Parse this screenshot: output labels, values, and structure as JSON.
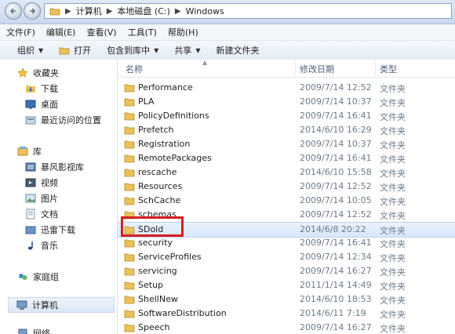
{
  "breadcrumb": [
    "计算机",
    "本地磁盘 (C:)",
    "Windows"
  ],
  "menu": [
    "文件(F)",
    "编辑(E)",
    "查看(V)",
    "工具(T)",
    "帮助(H)"
  ],
  "toolbar": {
    "organize": "组织",
    "open": "打开",
    "include": "包含到库中",
    "share": "共享",
    "new_folder": "新建文件夹"
  },
  "nav": {
    "favorites": "收藏夹",
    "downloads": "下载",
    "desktop": "桌面",
    "recent": "最近访问的位置",
    "libraries": "库",
    "storm": "暴风影视库",
    "videos": "视频",
    "pictures": "图片",
    "documents": "文档",
    "xunlei": "迅雷下载",
    "music": "音乐",
    "homegroup": "家庭组",
    "computer": "计算机",
    "network": "网络"
  },
  "columns": {
    "name": "名称",
    "date": "修改日期",
    "type": "类型"
  },
  "files": [
    {
      "name": "Performance",
      "date": "2009/7/14 12:52",
      "type": "文件夹"
    },
    {
      "name": "PLA",
      "date": "2009/7/14 10:37",
      "type": "文件夹"
    },
    {
      "name": "PolicyDefinitions",
      "date": "2009/7/14 16:41",
      "type": "文件夹"
    },
    {
      "name": "Prefetch",
      "date": "2014/6/10 16:29",
      "type": "文件夹"
    },
    {
      "name": "Registration",
      "date": "2009/7/14 10:37",
      "type": "文件夹"
    },
    {
      "name": "RemotePackages",
      "date": "2009/7/14 16:41",
      "type": "文件夹"
    },
    {
      "name": "rescache",
      "date": "2014/6/10 15:58",
      "type": "文件夹"
    },
    {
      "name": "Resources",
      "date": "2009/7/14 12:52",
      "type": "文件夹"
    },
    {
      "name": "SchCache",
      "date": "2009/7/14 10:05",
      "type": "文件夹"
    },
    {
      "name": "schemas",
      "date": "2009/7/14 12:52",
      "type": "文件夹"
    },
    {
      "name": "SDold",
      "date": "2014/6/8 20:22",
      "type": "文件夹"
    },
    {
      "name": "security",
      "date": "2009/7/14 16:41",
      "type": "文件夹"
    },
    {
      "name": "ServiceProfiles",
      "date": "2009/7/14 12:34",
      "type": "文件夹"
    },
    {
      "name": "servicing",
      "date": "2009/7/14 16:27",
      "type": "文件夹"
    },
    {
      "name": "Setup",
      "date": "2011/1/14 14:49",
      "type": "文件夹"
    },
    {
      "name": "ShellNew",
      "date": "2014/6/10 18:53",
      "type": "文件夹"
    },
    {
      "name": "SoftwareDistribution",
      "date": "2014/6/11 7:19",
      "type": "文件夹"
    },
    {
      "name": "Speech",
      "date": "2009/7/14 16:27",
      "type": "文件夹"
    }
  ],
  "colors": {
    "folder": "#e9c25a",
    "highlight": "#d8e7fb",
    "annotation": "#d42020"
  }
}
